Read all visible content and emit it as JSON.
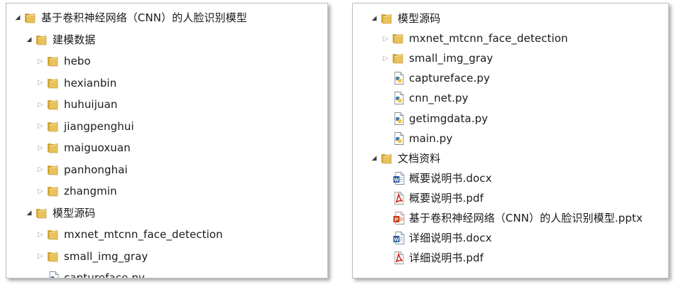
{
  "left_panel": {
    "items": [
      {
        "label": "基于卷积神经网络（CNN）的人脸识别模型",
        "type": "folder",
        "expanded": true,
        "depth": 0
      },
      {
        "label": "建模数据",
        "type": "folder",
        "expanded": true,
        "depth": 1
      },
      {
        "label": "hebo",
        "type": "folder",
        "expanded": false,
        "depth": 2
      },
      {
        "label": "hexianbin",
        "type": "folder",
        "expanded": false,
        "depth": 2
      },
      {
        "label": "huhuijuan",
        "type": "folder",
        "expanded": false,
        "depth": 2
      },
      {
        "label": "jiangpenghui",
        "type": "folder",
        "expanded": false,
        "depth": 2
      },
      {
        "label": "maiguoxuan",
        "type": "folder",
        "expanded": false,
        "depth": 2
      },
      {
        "label": "panhonghai",
        "type": "folder",
        "expanded": false,
        "depth": 2
      },
      {
        "label": "zhangmin",
        "type": "folder",
        "expanded": false,
        "depth": 2
      },
      {
        "label": "模型源码",
        "type": "folder",
        "expanded": true,
        "depth": 1
      },
      {
        "label": "mxnet_mtcnn_face_detection",
        "type": "folder",
        "expanded": false,
        "depth": 2
      },
      {
        "label": "small_img_gray",
        "type": "folder",
        "expanded": false,
        "depth": 2
      },
      {
        "label": "captureface.py",
        "type": "py",
        "depth": 2
      }
    ]
  },
  "right_panel": {
    "items": [
      {
        "label": "模型源码",
        "type": "folder",
        "expanded": true,
        "depth": 0
      },
      {
        "label": "mxnet_mtcnn_face_detection",
        "type": "folder",
        "expanded": false,
        "depth": 1
      },
      {
        "label": "small_img_gray",
        "type": "folder",
        "expanded": false,
        "depth": 1
      },
      {
        "label": "captureface.py",
        "type": "py",
        "depth": 1
      },
      {
        "label": "cnn_net.py",
        "type": "py",
        "depth": 1
      },
      {
        "label": "getimgdata.py",
        "type": "py",
        "depth": 1
      },
      {
        "label": "main.py",
        "type": "py",
        "depth": 1
      },
      {
        "label": "文档资料",
        "type": "folder",
        "expanded": true,
        "depth": 0
      },
      {
        "label": "概要说明书.docx",
        "type": "docx",
        "depth": 1
      },
      {
        "label": "概要说明书.pdf",
        "type": "pdf",
        "depth": 1
      },
      {
        "label": "基于卷积神经网络（CNN）的人脸识别模型.pptx",
        "type": "pptx",
        "depth": 1
      },
      {
        "label": "详细说明书.docx",
        "type": "docx",
        "depth": 1
      },
      {
        "label": "详细说明书.pdf",
        "type": "pdf",
        "depth": 1
      }
    ]
  },
  "colors": {
    "folder_body": "#e8c25a",
    "folder_tab": "#d4a93c",
    "py_blue": "#3b76b5",
    "py_yellow": "#f2c530",
    "word_blue": "#2b5797",
    "pdf_red": "#d0251c",
    "ppt_red": "#c43e1c"
  },
  "icons": {
    "folder": "folder-icon",
    "py": "python-file-icon",
    "docx": "word-file-icon",
    "pdf": "pdf-file-icon",
    "pptx": "powerpoint-file-icon",
    "expanded": "triangle-down-icon",
    "collapsed": "triangle-right-icon"
  }
}
